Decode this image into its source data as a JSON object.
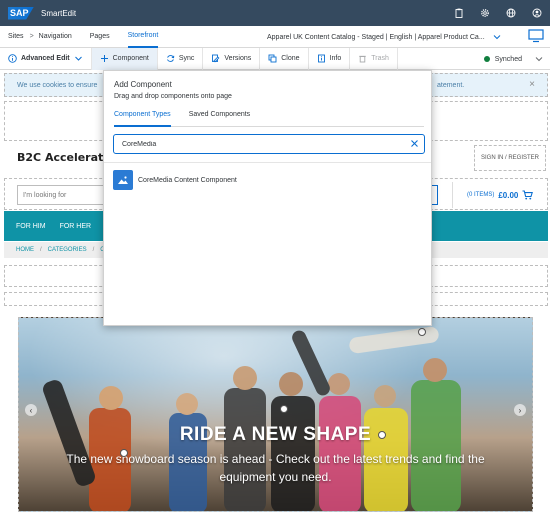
{
  "shell": {
    "logo": "SAP",
    "app_name": "SmartEdit"
  },
  "nav": {
    "sites": "Sites",
    "sep": ">",
    "navigation": "Navigation",
    "pages": "Pages",
    "storefront": "Storefront",
    "catalog": "Apparel UK Content Catalog - Staged | English | Apparel Product Ca..."
  },
  "toolbar": {
    "mode": "Advanced Edit",
    "component": "Component",
    "sync": "Sync",
    "versions": "Versions",
    "clone": "Clone",
    "info": "Info",
    "trash": "Trash",
    "status": "Synched"
  },
  "storefront": {
    "cookie_start": "We use cookies to ensure",
    "cookie_end": "atement.",
    "brand": "B2C Accelerator",
    "signin": "SIGN IN / REGISTER",
    "search_placeholder": "I'm looking for",
    "cart_items": "(0 ITEMS)",
    "cart_total": "£0.00",
    "categories": [
      "FOR HIM",
      "FOR HER"
    ],
    "breadcrumb": [
      "HOME",
      "CATEGORIES",
      "CO"
    ],
    "crumb_sep": "/",
    "hero_title": "RIDE A NEW SHAPE",
    "hero_subtitle": "The new snowboard season is ahead - Check out the latest trends and find the equipment you need."
  },
  "add_component": {
    "title": "Add Component",
    "subtitle": "Drag and drop components onto page",
    "tabs": [
      "Component Types",
      "Saved Components"
    ],
    "search_value": "CoreMedia",
    "results": [
      "CoreMedia Content Component"
    ]
  },
  "colors": {
    "shell": "#354a5f",
    "accent": "#0a6ed1",
    "category_bar": "#0f93a6",
    "synced": "#107e3e"
  }
}
